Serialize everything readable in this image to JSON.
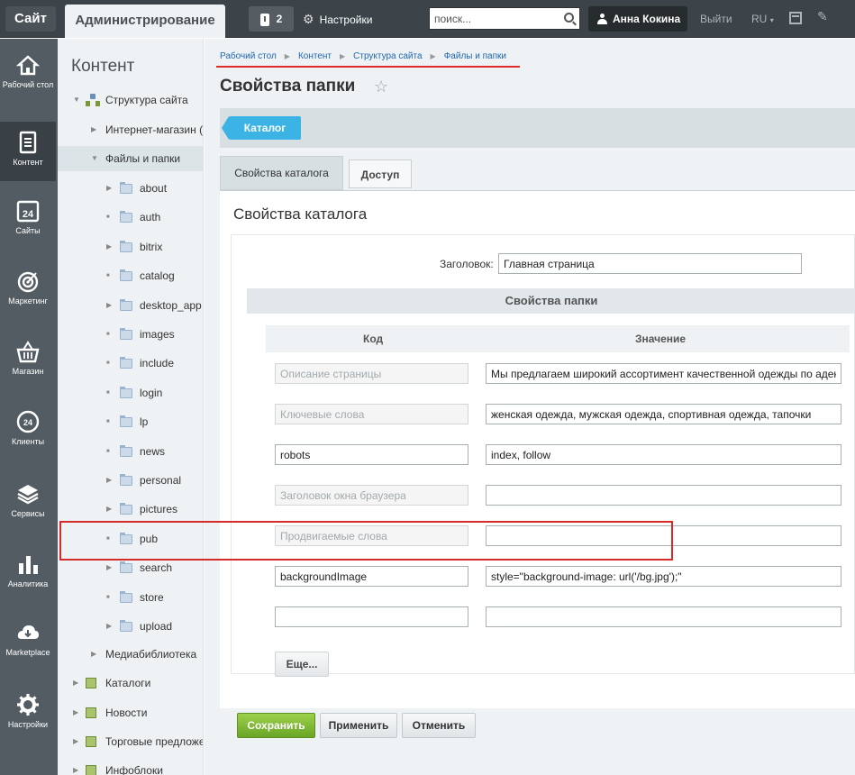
{
  "topbar": {
    "site_label": "Сайт",
    "admin_label": "Администрирование",
    "notifications_count": "2",
    "settings_label": "Настройки",
    "search_placeholder": "поиск...",
    "user_name": "Анна Кокина",
    "logout_label": "Выйти",
    "lang_label": "RU"
  },
  "leftnav": [
    {
      "label": "Рабочий стол",
      "icon": "home-icon"
    },
    {
      "label": "Контент",
      "icon": "document-icon"
    },
    {
      "label": "Сайты",
      "icon": "calendar-24-icon"
    },
    {
      "label": "Маркетинг",
      "icon": "target-icon"
    },
    {
      "label": "Магазин",
      "icon": "basket-icon"
    },
    {
      "label": "Клиенты",
      "icon": "clients-24-icon"
    },
    {
      "label": "Сервисы",
      "icon": "layers-icon"
    },
    {
      "label": "Аналитика",
      "icon": "bar-chart-icon"
    },
    {
      "label": "Marketplace",
      "icon": "cloud-download-icon"
    },
    {
      "label": "Настройки",
      "icon": "gear-icon"
    }
  ],
  "tree": {
    "title": "Контент",
    "site_structure": "Структура сайта",
    "shop": "Интернет-магазин (",
    "files": "Файлы и папки",
    "folders": [
      "about",
      "auth",
      "bitrix",
      "catalog",
      "desktop_app",
      "images",
      "include",
      "login",
      "lp",
      "news",
      "personal",
      "pictures",
      "pub",
      "search",
      "store",
      "upload"
    ],
    "media": "Медиабиблиотека",
    "catalogs": "Каталоги",
    "news": "Новости",
    "trade_offers": "Торговые предложе",
    "infoblocks": "Инфоблоки"
  },
  "breadcrumb": [
    "Рабочий стол",
    "Контент",
    "Структура сайта",
    "Файлы и папки"
  ],
  "page_title": "Свойства папки",
  "catalog_button": "Каталог",
  "tabs": [
    "Свойства каталога",
    "Доступ"
  ],
  "panel_title": "Свойства каталога",
  "form": {
    "title_label": "Заголовок:",
    "title_value": "Главная страница",
    "section_header": "Свойства папки",
    "col_code": "Код",
    "col_value": "Значение",
    "rows": [
      {
        "code": "",
        "code_placeholder": "Описание страницы",
        "value": "Мы предлагаем широкий ассортимент качественной одежды по адекватным ценам"
      },
      {
        "code": "",
        "code_placeholder": "Ключевые слова",
        "value": "женская одежда, мужская одежда, спортивная одежда, тапочки"
      },
      {
        "code": "robots",
        "code_placeholder": "",
        "value": "index, follow"
      },
      {
        "code": "",
        "code_placeholder": "Заголовок окна браузера",
        "value": ""
      },
      {
        "code": "",
        "code_placeholder": "Продвигаемые слова",
        "value": ""
      },
      {
        "code": "backgroundImage",
        "code_placeholder": "",
        "value": "style=\"background-image: url('/bg.jpg');\""
      },
      {
        "code": "",
        "code_placeholder": "",
        "value": ""
      }
    ],
    "more_label": "Еще..."
  },
  "actions": {
    "save": "Сохранить",
    "apply": "Применить",
    "cancel": "Отменить"
  },
  "colors": {
    "save_green": "#6aa526",
    "catalog_blue": "#3bb4e5",
    "highlight_red": "#d62b2b"
  }
}
